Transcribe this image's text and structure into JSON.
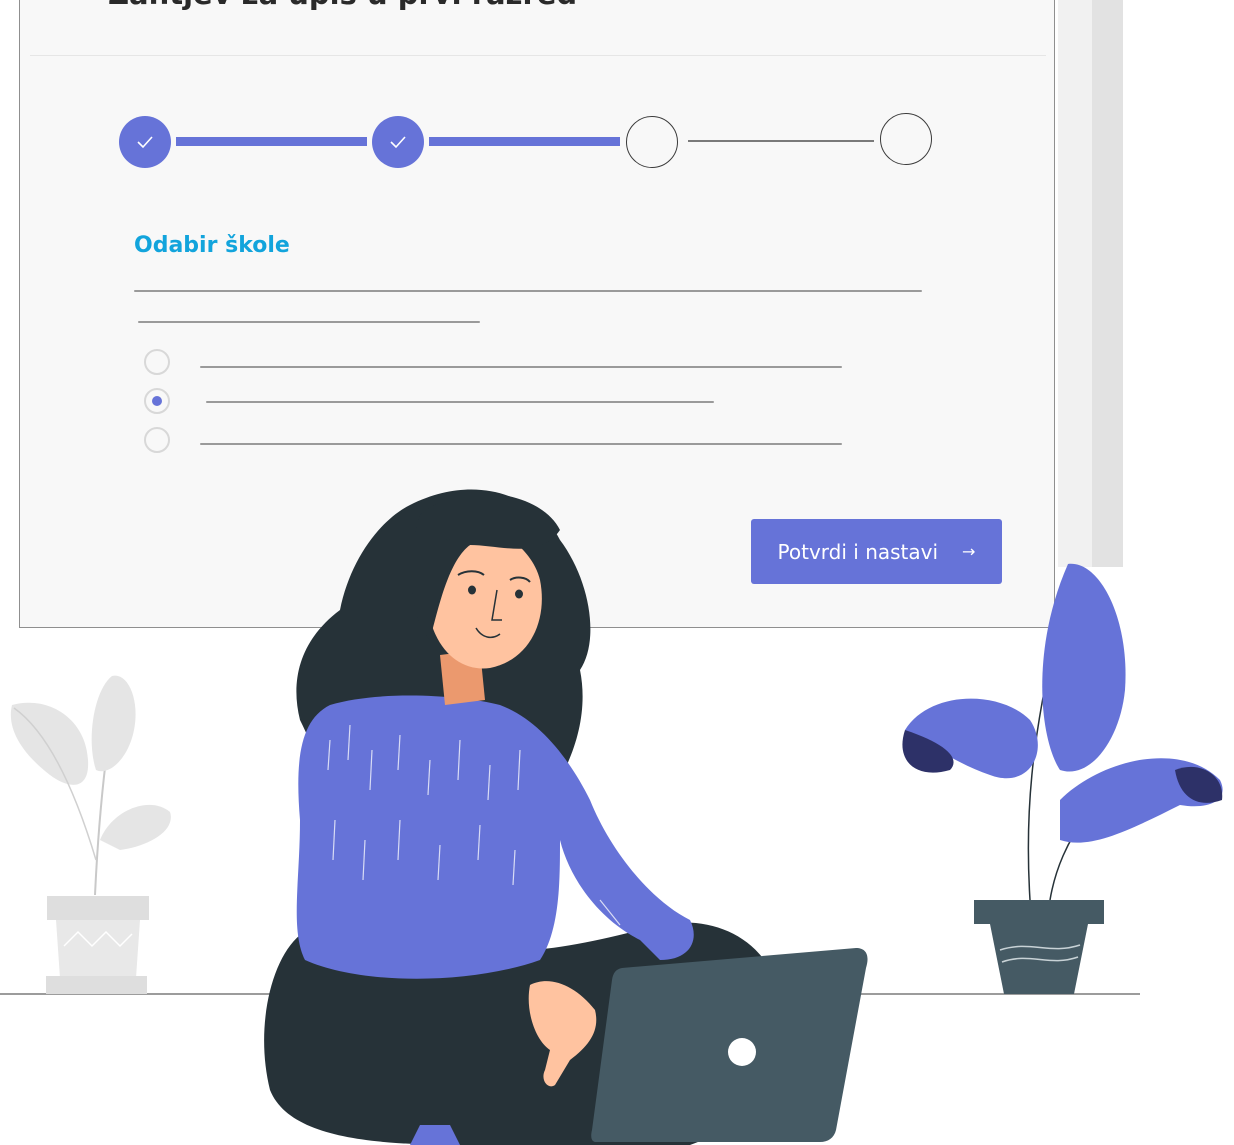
{
  "form": {
    "title": "Zahtjev za upis u prvi razred",
    "steps": [
      {
        "status": "completed",
        "icon": "checkmark-icon"
      },
      {
        "status": "completed",
        "icon": "checkmark-icon"
      },
      {
        "status": "pending"
      },
      {
        "status": "pending"
      }
    ],
    "section_title": "Odabir škole",
    "radio_options": [
      {
        "selected": false
      },
      {
        "selected": true
      },
      {
        "selected": false
      }
    ],
    "submit_label": "Potvrdi i nastavi",
    "submit_icon": "arrow-right-icon"
  },
  "colors": {
    "accent": "#6673d8",
    "section_title": "#12a4dc",
    "dark": "#263238",
    "skin": "#ffc3a0"
  }
}
